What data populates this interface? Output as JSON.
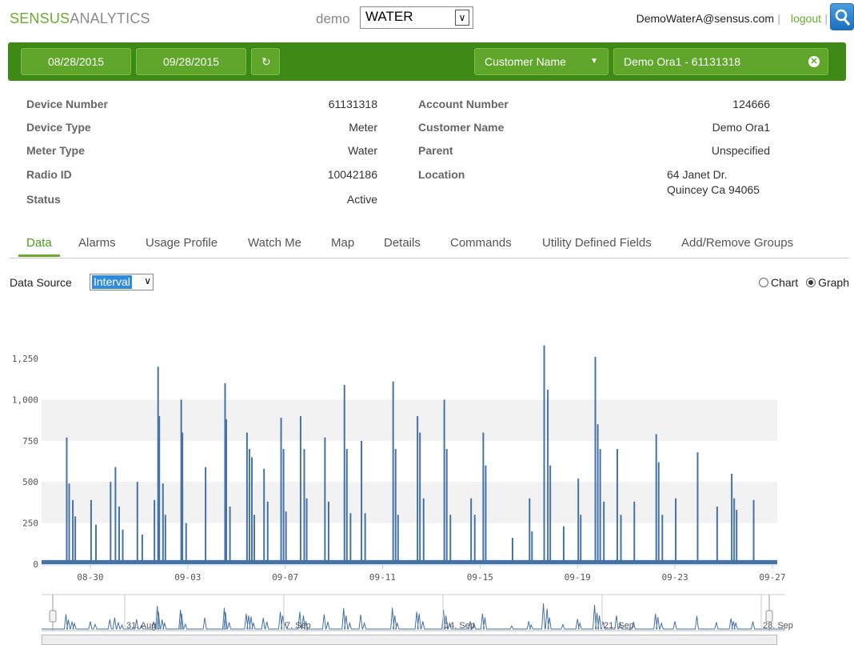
{
  "header": {
    "brand_part1": "SENSUS",
    "brand_part2": "ANALYTICS",
    "tenant": "demo",
    "utility_selected": "WATER",
    "user_email": "DemoWaterA@sensus.com",
    "logout_label": "logout"
  },
  "filters": {
    "start_date": "08/28/2015",
    "end_date": "09/28/2015",
    "search_field": "Customer Name",
    "search_value": "Demo Ora1 - 61131318"
  },
  "device": {
    "rows_left": [
      {
        "label": "Device Number",
        "value": "61131318"
      },
      {
        "label": "Device Type",
        "value": "Meter"
      },
      {
        "label": "Meter Type",
        "value": "Water"
      },
      {
        "label": "Radio ID",
        "value": "10042186"
      },
      {
        "label": "Status",
        "value": "Active"
      }
    ],
    "rows_right": [
      {
        "label": "Account Number",
        "value": "124666"
      },
      {
        "label": "Customer Name",
        "value": "Demo Ora1"
      },
      {
        "label": "Parent",
        "value": "Unspecified"
      },
      {
        "label": "Location",
        "value_line1": "64 Janet Dr.",
        "value_line2": "Quincey Ca 94065"
      }
    ]
  },
  "tabs": [
    "Data",
    "Alarms",
    "Usage Profile",
    "Watch Me",
    "Map",
    "Details",
    "Commands",
    "Utility Defined Fields",
    "Add/Remove Groups"
  ],
  "data_source": {
    "label": "Data Source",
    "selected": "Interval"
  },
  "view_toggle": {
    "chart_label": "Chart",
    "graph_label": "Graph",
    "selected": "Graph"
  },
  "colors": {
    "brand_green": "#6cab2f",
    "filter_bar": "#3f8a16",
    "series": "#4572a7"
  },
  "chart_data": {
    "type": "bar",
    "x_tick_labels": [
      "08-30",
      "09-03",
      "09-07",
      "09-11",
      "09-15",
      "09-19",
      "09-23",
      "09-27"
    ],
    "y_tick_labels": [
      "0",
      "250",
      "500",
      "750",
      "1,000",
      "1,250"
    ],
    "ylim": [
      0,
      1250
    ],
    "baseline_value": 25,
    "series": [
      {
        "values_peaks": [
          {
            "day": 1.0,
            "v": 770
          },
          {
            "day": 1.1,
            "v": 490
          },
          {
            "day": 1.25,
            "v": 390
          },
          {
            "day": 1.35,
            "v": 290
          },
          {
            "day": 2.0,
            "v": 390
          },
          {
            "day": 2.2,
            "v": 240
          },
          {
            "day": 2.8,
            "v": 500
          },
          {
            "day": 3.0,
            "v": 590
          },
          {
            "day": 3.15,
            "v": 350
          },
          {
            "day": 3.3,
            "v": 210
          },
          {
            "day": 3.9,
            "v": 500
          },
          {
            "day": 4.1,
            "v": 180
          },
          {
            "day": 4.6,
            "v": 390
          },
          {
            "day": 4.75,
            "v": 1200
          },
          {
            "day": 4.8,
            "v": 900
          },
          {
            "day": 4.95,
            "v": 490
          },
          {
            "day": 5.05,
            "v": 300
          },
          {
            "day": 5.7,
            "v": 1000
          },
          {
            "day": 5.75,
            "v": 800
          },
          {
            "day": 5.9,
            "v": 250
          },
          {
            "day": 6.7,
            "v": 590
          },
          {
            "day": 7.5,
            "v": 1100
          },
          {
            "day": 7.55,
            "v": 880
          },
          {
            "day": 7.7,
            "v": 350
          },
          {
            "day": 8.4,
            "v": 800
          },
          {
            "day": 8.5,
            "v": 700
          },
          {
            "day": 8.6,
            "v": 650
          },
          {
            "day": 8.7,
            "v": 300
          },
          {
            "day": 9.1,
            "v": 580
          },
          {
            "day": 9.25,
            "v": 380
          },
          {
            "day": 9.8,
            "v": 890
          },
          {
            "day": 9.9,
            "v": 700
          },
          {
            "day": 10.0,
            "v": 320
          },
          {
            "day": 10.6,
            "v": 900
          },
          {
            "day": 10.75,
            "v": 700
          },
          {
            "day": 10.85,
            "v": 400
          },
          {
            "day": 11.6,
            "v": 770
          },
          {
            "day": 11.75,
            "v": 380
          },
          {
            "day": 12.4,
            "v": 1090
          },
          {
            "day": 12.5,
            "v": 700
          },
          {
            "day": 12.65,
            "v": 310
          },
          {
            "day": 13.1,
            "v": 750
          },
          {
            "day": 13.25,
            "v": 310
          },
          {
            "day": 14.4,
            "v": 1110
          },
          {
            "day": 14.5,
            "v": 700
          },
          {
            "day": 14.6,
            "v": 300
          },
          {
            "day": 15.4,
            "v": 900
          },
          {
            "day": 15.5,
            "v": 800
          },
          {
            "day": 15.65,
            "v": 400
          },
          {
            "day": 16.5,
            "v": 1000
          },
          {
            "day": 16.6,
            "v": 700
          },
          {
            "day": 16.75,
            "v": 300
          },
          {
            "day": 17.6,
            "v": 400
          },
          {
            "day": 17.75,
            "v": 300
          },
          {
            "day": 18.1,
            "v": 800
          },
          {
            "day": 18.2,
            "v": 600
          },
          {
            "day": 19.3,
            "v": 160
          },
          {
            "day": 20.0,
            "v": 400
          },
          {
            "day": 20.1,
            "v": 200
          },
          {
            "day": 20.6,
            "v": 1330
          },
          {
            "day": 20.75,
            "v": 1060
          },
          {
            "day": 20.85,
            "v": 600
          },
          {
            "day": 21.4,
            "v": 230
          },
          {
            "day": 22.0,
            "v": 520
          },
          {
            "day": 22.1,
            "v": 300
          },
          {
            "day": 22.7,
            "v": 1260
          },
          {
            "day": 22.8,
            "v": 850
          },
          {
            "day": 22.9,
            "v": 700
          },
          {
            "day": 23.05,
            "v": 380
          },
          {
            "day": 23.6,
            "v": 700
          },
          {
            "day": 23.75,
            "v": 300
          },
          {
            "day": 24.3,
            "v": 380
          },
          {
            "day": 25.2,
            "v": 790
          },
          {
            "day": 25.3,
            "v": 620
          },
          {
            "day": 25.45,
            "v": 300
          },
          {
            "day": 26.0,
            "v": 400
          },
          {
            "day": 26.9,
            "v": 680
          },
          {
            "day": 27.7,
            "v": 350
          },
          {
            "day": 28.3,
            "v": 550
          },
          {
            "day": 28.4,
            "v": 400
          },
          {
            "day": 28.5,
            "v": 330
          },
          {
            "day": 29.2,
            "v": 390
          }
        ]
      }
    ],
    "navigator_labels": [
      "31. Aug",
      "7. Sep",
      "14. Sep",
      "21. Sep",
      "28. Sep"
    ],
    "grid": true
  }
}
